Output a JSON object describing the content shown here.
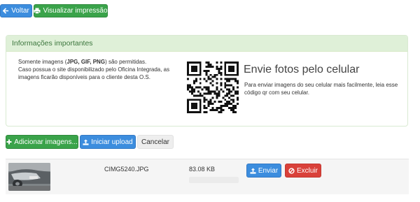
{
  "toolbar": {
    "back_label": "Voltar",
    "print_label": "Visualizar impressão"
  },
  "panel": {
    "title": "Informações importantes",
    "info_prefix": "Somente imagens (",
    "info_formats": "JPG, GIF, PNG",
    "info_suffix": ") são permitidas.",
    "info_line2": "Caso possua o site disponibilizado pelo Oficina Integrada, as imagens ficarão disponíveis para o cliente desta O.S.",
    "qr_title": "Envie fotos pelo celular",
    "qr_description": "Para enviar imagens do seu celular mais facilmente, leia esse código qr com seu celular."
  },
  "upload_bar": {
    "add_label": "Adicionar imagens...",
    "start_label": "Iniciar upload",
    "cancel_label": "Cancelar"
  },
  "files": [
    {
      "name": "CIMG5240.JPG",
      "size": "83.08 KB",
      "progress": 0,
      "send_label": "Enviar",
      "delete_label": "Excluir"
    }
  ],
  "colors": {
    "primary": "#3c8dde",
    "success": "#3aa34a",
    "danger": "#d9413a",
    "panel_heading_bg": "#dff0d8",
    "panel_heading_text": "#3c763d"
  },
  "icons": {
    "back": "arrow-left-icon",
    "print": "print-icon",
    "add": "plus-icon",
    "upload": "upload-icon",
    "delete": "ban-icon"
  }
}
